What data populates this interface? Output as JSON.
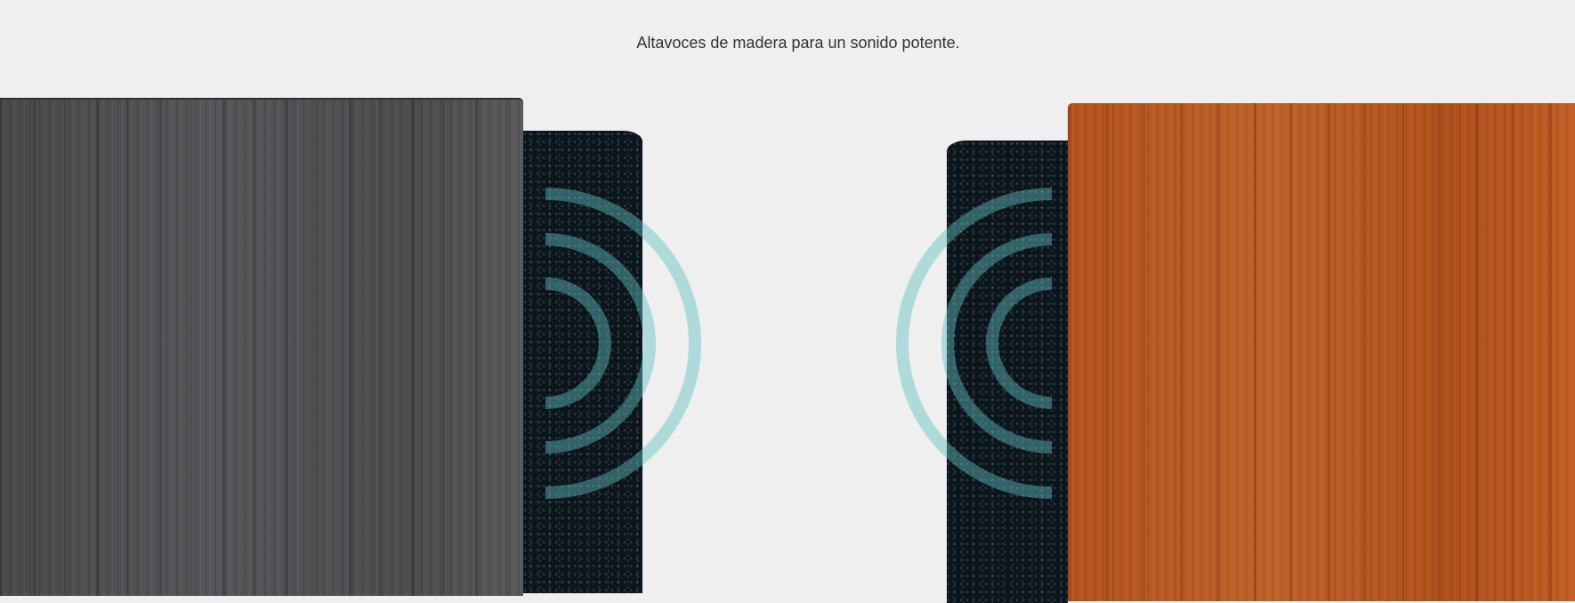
{
  "caption": "Altavoces de madera para un sonido potente.",
  "colors": {
    "background": "#efefef",
    "wave": "#4fb3b8",
    "left_cabinet": "#4d4d50",
    "right_cabinet": "#b8571f",
    "grille": "#0b151c"
  },
  "images": {
    "left": "dark-wood-speaker",
    "right": "cherry-wood-speaker",
    "icon": "sound-wave-icon"
  }
}
